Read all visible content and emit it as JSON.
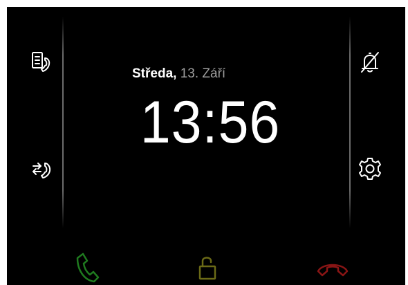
{
  "status": {
    "day_name": "Středa",
    "separator": ",",
    "date_rest": "13. Září",
    "time": "13:56"
  },
  "left_buttons": [
    {
      "name": "call-log",
      "icon": "phone-list-icon"
    },
    {
      "name": "call-forward",
      "icon": "phone-forward-icon"
    }
  ],
  "right_buttons": [
    {
      "name": "mute",
      "icon": "bell-off-icon"
    },
    {
      "name": "settings",
      "icon": "gear-icon"
    }
  ],
  "bottom_buttons": [
    {
      "name": "accept-call",
      "icon": "phone-icon",
      "color": "#1f7a1f"
    },
    {
      "name": "unlock",
      "icon": "padlock-open-icon",
      "color": "#6b6a16"
    },
    {
      "name": "hang-up",
      "icon": "phone-hangup-icon",
      "color": "#8a1515"
    }
  ],
  "colors": {
    "background": "#000000",
    "primary_text": "#ffffff",
    "secondary_text": "#9e9e9e"
  }
}
